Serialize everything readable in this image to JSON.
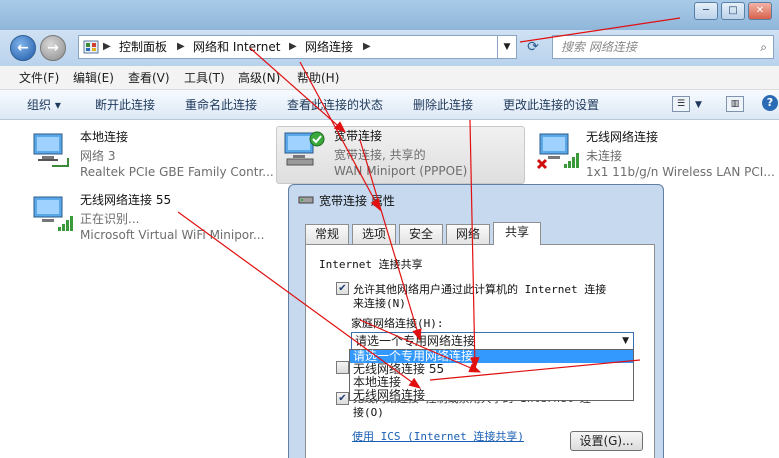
{
  "window": {
    "minimize": "─",
    "maximize": "□",
    "close": "✕"
  },
  "address": {
    "crumbs": [
      "控制面板",
      "网络和 Internet",
      "网络连接"
    ],
    "search_placeholder": "搜索 网络连接"
  },
  "menu": {
    "items": [
      "文件(F)",
      "编辑(E)",
      "查看(V)",
      "工具(T)",
      "高级(N)",
      "帮助(H)"
    ]
  },
  "toolbar": {
    "organize": "组织 ▾",
    "disconnect": "断开此连接",
    "rename": "重命名此连接",
    "status": "查看此连接的状态",
    "delete": "删除此连接",
    "settings": "更改此连接的设置"
  },
  "connections": [
    {
      "name": "本地连接",
      "status": "网络 3",
      "device": "Realtek PCIe GBE Family Contr..."
    },
    {
      "name": "宽带连接",
      "status": "宽带连接, 共享的",
      "device": "WAN Miniport (PPPOE)"
    },
    {
      "name": "无线网络连接",
      "status": "未连接",
      "device": "1x1 11b/g/n Wireless LAN PCI..."
    },
    {
      "name": "无线网络连接 55",
      "status": "正在识别...",
      "device": "Microsoft Virtual WiFi Minipor..."
    }
  ],
  "dialog": {
    "title": "宽带连接 属性",
    "tabs": [
      "常规",
      "选项",
      "安全",
      "网络",
      "共享"
    ],
    "group_label": "Internet 连接共享",
    "allow_line1": "允许其他网络用户通过此计算机的 Internet 连接",
    "allow_line2": "来连接(N)",
    "home_label": "家庭网络连接(H):",
    "select_value": "请选一个专用网络连接",
    "options": [
      "请选一个专用网络连接",
      "无线网络连接 55",
      "本地连接",
      "无线网络连接"
    ],
    "behind_text": "无线网络连接 控制或禁用共享的 Internet 连",
    "behind_text2": "接(O)",
    "link": "使用 ICS (Internet 连接共享)",
    "settings_button": "设置(G)..."
  },
  "colors": {
    "annotation_arrow": "#e01010",
    "highlight": "#3399ff",
    "link": "#1a5fb4"
  }
}
